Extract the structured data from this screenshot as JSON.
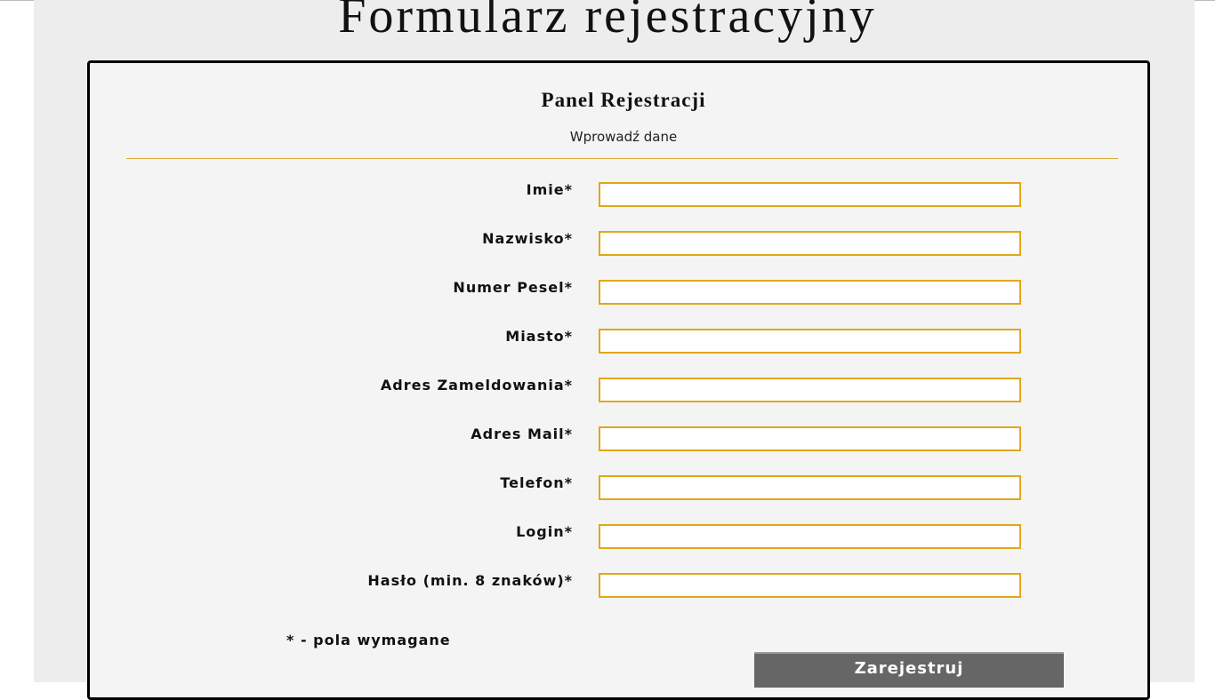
{
  "page": {
    "title": "Formularz rejestracyjny"
  },
  "panel": {
    "title": "Panel Rejestracji",
    "subtitle": "Wprowadź dane"
  },
  "form": {
    "fields": [
      {
        "label": "Imie*",
        "value": ""
      },
      {
        "label": "Nazwisko*",
        "value": ""
      },
      {
        "label": "Numer Pesel*",
        "value": ""
      },
      {
        "label": "Miasto*",
        "value": ""
      },
      {
        "label": "Adres Zameldowania*",
        "value": ""
      },
      {
        "label": "Adres Mail*",
        "value": ""
      },
      {
        "label": "Telefon*",
        "value": ""
      },
      {
        "label": "Login*",
        "value": ""
      },
      {
        "label": "Hasło (min. 8 znaków)*",
        "value": ""
      }
    ],
    "required_note": "* - pola wymagane",
    "submit_label": "Zarejestruj"
  },
  "colors": {
    "background": "#ededed",
    "panel_background": "#f4f4f4",
    "input_border": "#e1a71a",
    "divider": "#d9a837",
    "button_background": "#666666",
    "button_text": "#ffffff"
  }
}
